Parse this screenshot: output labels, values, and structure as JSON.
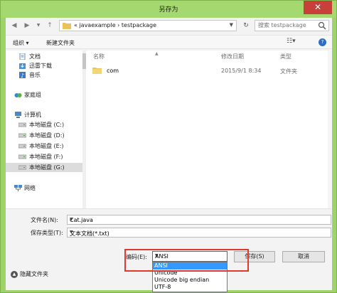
{
  "window": {
    "title": "另存为",
    "close_glyph": "✕"
  },
  "address": {
    "crumbs": "« javaexample  ›  testpackage",
    "search_placeholder": "搜索 testpackage"
  },
  "toolbar": {
    "organize": "组织 ▾",
    "new_folder": "新建文件夹"
  },
  "nav": {
    "items": [
      {
        "label": "文档",
        "icon": "document-icon"
      },
      {
        "label": "迅雷下载",
        "icon": "download-icon"
      },
      {
        "label": "音乐",
        "icon": "music-icon"
      },
      {
        "label": "家庭组",
        "icon": "homegroup-icon"
      },
      {
        "label": "计算机",
        "icon": "computer-icon"
      },
      {
        "label": "本地磁盘 (C:)",
        "icon": "drive-icon"
      },
      {
        "label": "本地磁盘 (D:)",
        "icon": "drive-icon"
      },
      {
        "label": "本地磁盘 (E:)",
        "icon": "drive-icon"
      },
      {
        "label": "本地磁盘 (F:)",
        "icon": "drive-icon"
      },
      {
        "label": "本地磁盘 (G:)",
        "icon": "drive-icon"
      },
      {
        "label": "网络",
        "icon": "network-icon"
      }
    ]
  },
  "filelist": {
    "columns": [
      "名称",
      "修改日期",
      "类型"
    ],
    "rows": [
      {
        "name": "com",
        "date": "2015/9/1 8:34",
        "type": "文件夹"
      }
    ]
  },
  "form": {
    "filename_label": "文件名(N):",
    "filename_value": "Cat.java",
    "filetype_label": "保存类型(T):",
    "filetype_value": "文本文档(*.txt)",
    "hide_folders": "隐藏文件夹",
    "encoding_label": "编码(E):",
    "encoding_value": "ANSI",
    "save": "保存(S)",
    "cancel": "取消"
  },
  "encoding_options": [
    "ANSI",
    "Unicode",
    "Unicode big endian",
    "UTF-8"
  ],
  "colors": {
    "frame": "#9ed36a",
    "highlight": "#e03a2e",
    "selected_option": "#3399ff"
  }
}
